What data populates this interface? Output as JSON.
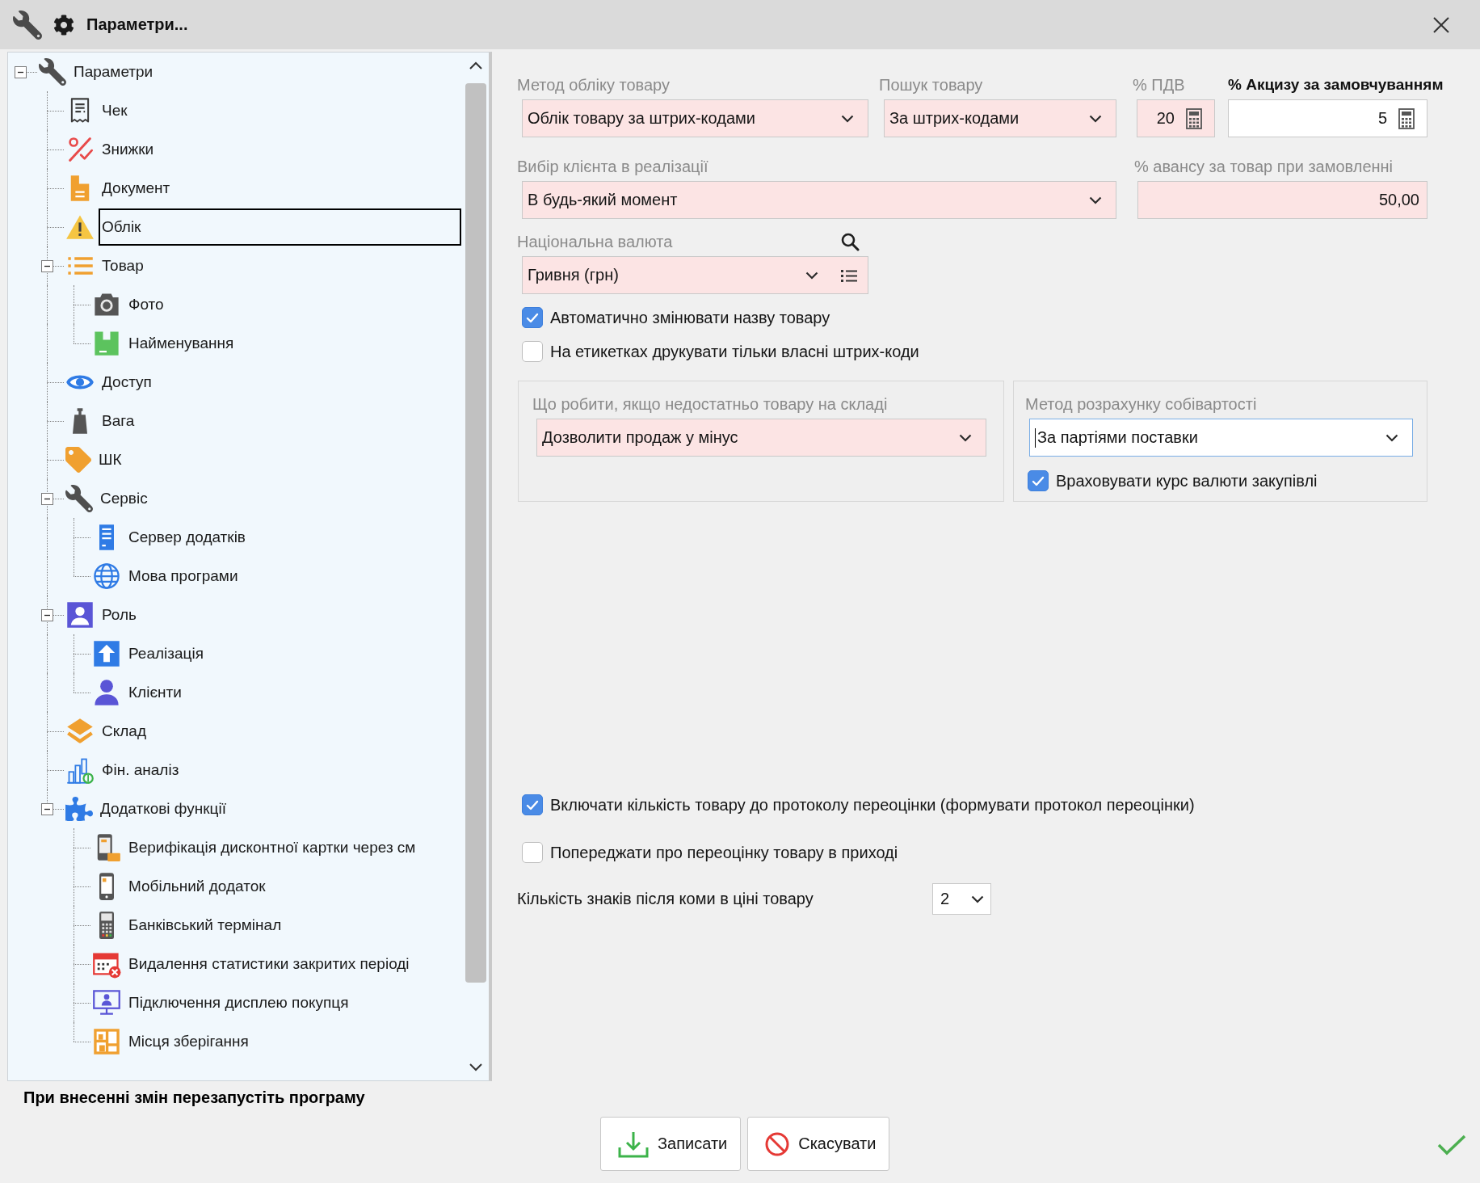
{
  "window": {
    "title": "Параметри..."
  },
  "tree": [
    {
      "label": "Параметри",
      "selected": false,
      "expanded": true,
      "children": [
        {
          "label": "Чек",
          "selected": false
        },
        {
          "label": "Знижки",
          "selected": false
        },
        {
          "label": "Документ",
          "selected": false
        },
        {
          "label": "Облік",
          "selected": true
        },
        {
          "label": "Товар",
          "selected": false,
          "expanded": true,
          "children": [
            {
              "label": "Фото",
              "selected": false
            },
            {
              "label": "Найменування",
              "selected": false
            }
          ]
        },
        {
          "label": "Доступ",
          "selected": false
        },
        {
          "label": "Вага",
          "selected": false
        },
        {
          "label": "ШК",
          "selected": false
        },
        {
          "label": "Сервіс",
          "selected": false,
          "expanded": true,
          "children": [
            {
              "label": "Сервер додатків",
              "selected": false
            },
            {
              "label": "Мова програми",
              "selected": false
            }
          ]
        },
        {
          "label": "Роль",
          "selected": false,
          "expanded": true,
          "children": [
            {
              "label": "Реалізація",
              "selected": false
            },
            {
              "label": "Клієнти",
              "selected": false
            }
          ]
        },
        {
          "label": "Склад",
          "selected": false
        },
        {
          "label": "Фін. аналіз",
          "selected": false
        },
        {
          "label": "Додаткові функції",
          "selected": false,
          "expanded": true,
          "children": [
            {
              "label": "Верифікація дисконтної картки через см",
              "selected": false
            },
            {
              "label": "Мобільний додаток",
              "selected": false
            },
            {
              "label": "Банківський термінал",
              "selected": false
            },
            {
              "label": "Видалення статистики закритих періоді",
              "selected": false
            },
            {
              "label": "Підключення дисплею покупця",
              "selected": false
            },
            {
              "label": "Місця зберігання",
              "selected": false
            }
          ]
        }
      ]
    }
  ],
  "form": {
    "row_1": [
      {
        "kind": "combo",
        "label": "Метод обліку товару",
        "value": "Облік товару за штрих-кодами",
        "highlighted": true,
        "emphasized": false
      },
      {
        "kind": "combo",
        "label": "Пошук товару",
        "value": "За штрих-кодами",
        "highlighted": true,
        "emphasized": false
      },
      {
        "kind": "number",
        "label": "% ПДВ",
        "value": "20",
        "highlighted": true,
        "emphasized": false
      },
      {
        "kind": "number",
        "label": "% Акцизу за замовчуванням",
        "value": "5",
        "highlighted": false,
        "emphasized": true
      }
    ],
    "row_2": [
      {
        "kind": "combo",
        "label": "Вибір клієнта в реалізації",
        "value": "В будь-який момент",
        "highlighted": true,
        "emphasized": false
      },
      {
        "kind": "text",
        "label": "% авансу за товар при замовленні",
        "value": "50,00",
        "highlighted": true,
        "emphasized": false
      }
    ],
    "row_3": [
      {
        "kind": "lookup",
        "label": "Національна валюта",
        "value": "Гривня (грн)",
        "highlighted": true,
        "emphasized": false
      }
    ],
    "options_1": [
      {
        "label": "Автоматично змінювати назву товару",
        "checked": true
      },
      {
        "label": "На етикетках друкувати тільки власні штрих-коди",
        "checked": false
      }
    ],
    "groups": [
      {
        "title": "Що робити, якщо недостатньо товару на складі",
        "field": {
          "kind": "combo",
          "value": "Дозволити продаж у мінус",
          "highlighted": true,
          "focused": false
        }
      },
      {
        "title": "Метод розрахунку собівартості",
        "field": {
          "kind": "combo",
          "value": "За партіями поставки",
          "highlighted": false,
          "focused": true
        },
        "options": [
          {
            "label": "Враховувати курс валюти закупівлі",
            "checked": true
          }
        ]
      }
    ],
    "options_2": [
      {
        "label": "Включати кількість товару до протоколу переоцінки (формувати протокол переоцінки)",
        "checked": true
      },
      {
        "label": "Попереджати про переоцінку товару в приході",
        "checked": false
      }
    ],
    "decimals": {
      "label": "Кількість знаків після коми в ціні товару",
      "value": "2"
    }
  },
  "footer": {
    "note": "При внесенні змін перезапустіть програму",
    "buttons": [
      {
        "kind": "save",
        "label": "Записати"
      },
      {
        "kind": "cancel",
        "label": "Скасувати"
      }
    ]
  }
}
